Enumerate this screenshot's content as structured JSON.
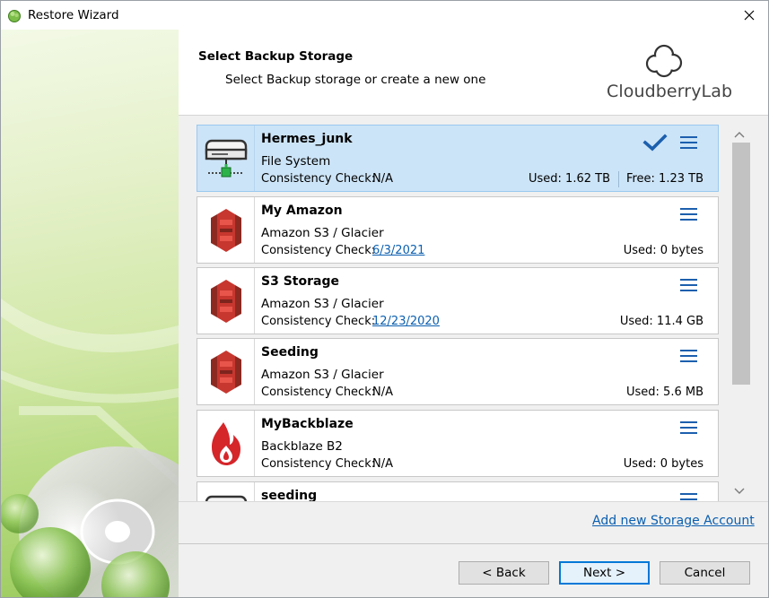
{
  "window": {
    "title": "Restore Wizard",
    "close_icon": "close-icon"
  },
  "header": {
    "title": "Select Backup Storage",
    "subtitle": "Select Backup storage or create a new one",
    "logo_text": "CloudberryLab"
  },
  "storages": [
    {
      "name": "Hermes_junk",
      "type": "File System",
      "consistency_label": "Consistency Check:",
      "consistency_value": "N/A",
      "used": "Used: 1.62 TB",
      "free": "Free: 1.23 TB",
      "icon": "hard-drive-icon",
      "selected": true
    },
    {
      "name": "My Amazon",
      "type": "Amazon S3 / Glacier",
      "consistency_label": "Consistency Check:",
      "consistency_value": "6/3/2021",
      "used": "Used: 0 bytes",
      "icon": "amazon-s3-icon",
      "selected": false
    },
    {
      "name": "S3 Storage",
      "type": "Amazon S3 / Glacier",
      "consistency_label": "Consistency Check:",
      "consistency_value": "12/23/2020",
      "used": "Used: 11.4 GB",
      "icon": "amazon-s3-icon",
      "selected": false
    },
    {
      "name": "Seeding",
      "type": "Amazon S3 / Glacier",
      "consistency_label": "Consistency Check:",
      "consistency_value": "N/A",
      "used": "Used: 5.6 MB",
      "icon": "amazon-s3-icon",
      "selected": false
    },
    {
      "name": "MyBackblaze",
      "type": "Backblaze B2",
      "consistency_label": "Consistency Check:",
      "consistency_value": "N/A",
      "used": "Used: 0 bytes",
      "icon": "backblaze-flame-icon",
      "selected": false
    },
    {
      "name": "seeding",
      "icon": "hard-drive-icon",
      "selected": false
    }
  ],
  "add_storage_link": "Add new Storage Account",
  "buttons": {
    "back": "< Back",
    "next": "Next >",
    "cancel": "Cancel"
  },
  "colors": {
    "selected_bg": "#cce4f7",
    "link": "#0b5fb0",
    "menu_icon": "#1c5fae",
    "s3_red": "#c7372f",
    "backblaze_red": "#d5262a"
  }
}
